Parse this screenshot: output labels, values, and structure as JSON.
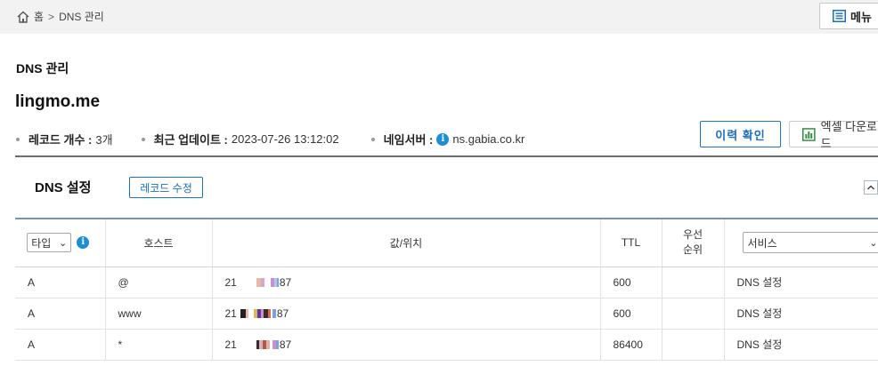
{
  "breadcrumb": {
    "home": "홈",
    "separator": ">",
    "current": "DNS 관리"
  },
  "menu_button": {
    "label": "메뉴"
  },
  "page_title": "DNS 관리",
  "domain": "lingmo.me",
  "meta": {
    "record_count_label": "레코드 개수 :",
    "record_count_value": "3개",
    "updated_label": "최근 업데이트 :",
    "updated_value": "2023-07-26 13:12:02",
    "nameserver_label": "네임서버 :",
    "nameserver_value": "ns.gabia.co.kr"
  },
  "buttons": {
    "history": "이력 확인",
    "excel": "엑셀 다운로드"
  },
  "section": {
    "title": "DNS 설정",
    "edit_label": "레코드 수정"
  },
  "table": {
    "headers": {
      "type_select": "타입",
      "host": "호스트",
      "value": "값/위치",
      "ttl": "TTL",
      "priority_line1": "우선",
      "priority_line2": "순위",
      "service_select": "서비스"
    },
    "rows": [
      {
        "type": "A",
        "host": "@",
        "value_prefix": "21",
        "value_suffix": "87",
        "ttl": "600",
        "priority": "",
        "service": "DNS 설정"
      },
      {
        "type": "A",
        "host": "www",
        "value_prefix": "21",
        "value_suffix": "87",
        "ttl": "600",
        "priority": "",
        "service": "DNS 설정"
      },
      {
        "type": "A",
        "host": "*",
        "value_prefix": "21",
        "value_suffix": "87",
        "ttl": "86400",
        "priority": "",
        "service": "DNS 설정"
      }
    ]
  },
  "colors": {
    "accent": "#1a73c4",
    "info": "#1b8ed6",
    "excel_green": "#2e8b3a",
    "header_rule": "#7894a8"
  }
}
